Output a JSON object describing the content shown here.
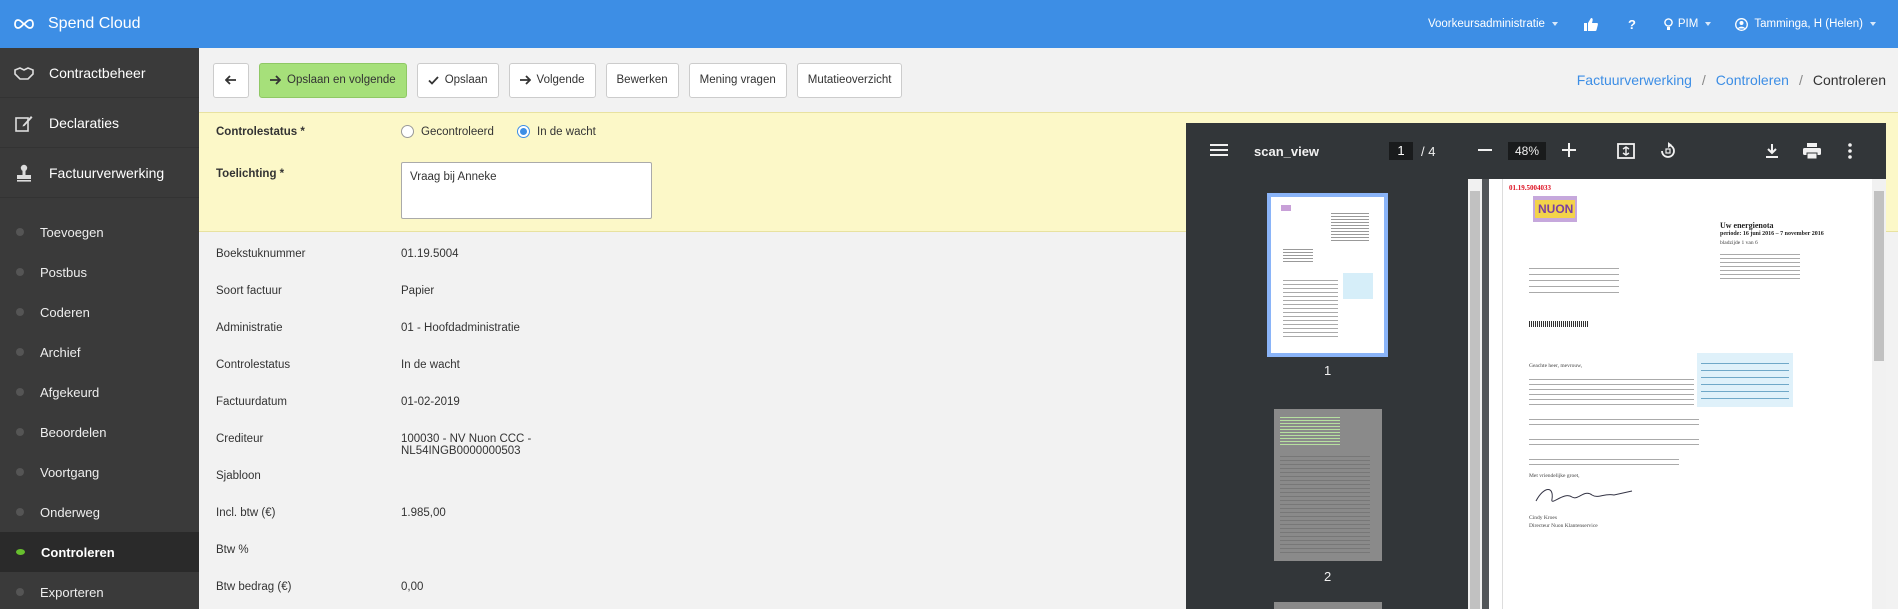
{
  "app": {
    "title": "Spend Cloud"
  },
  "topnav": {
    "administration": "Voorkeursadministratie",
    "pim": "PIM",
    "user": "Tamminga, H (Helen)"
  },
  "sidebar": {
    "main": [
      {
        "label": "Contractbeheer",
        "icon": "handshake-icon"
      },
      {
        "label": "Declaraties",
        "icon": "pencil-icon"
      },
      {
        "label": "Factuurverwerking",
        "icon": "stamp-icon"
      }
    ],
    "sub": [
      {
        "label": "Toevoegen"
      },
      {
        "label": "Postbus"
      },
      {
        "label": "Coderen"
      },
      {
        "label": "Archief"
      },
      {
        "label": "Afgekeurd"
      },
      {
        "label": "Beoordelen"
      },
      {
        "label": "Voortgang"
      },
      {
        "label": "Onderweg"
      },
      {
        "label": "Controleren",
        "active": true
      },
      {
        "label": "Exporteren"
      }
    ]
  },
  "toolbar": {
    "save_next": "Opslaan en volgende",
    "save": "Opslaan",
    "next": "Volgende",
    "edit": "Bewerken",
    "opinion": "Mening vragen",
    "mutations": "Mutatieoverzicht"
  },
  "breadcrumb": {
    "items": [
      "Factuurverwerking",
      "Controleren"
    ],
    "current": "Controleren"
  },
  "form": {
    "status_label": "Controlestatus *",
    "opt_checked": "Gecontroleerd",
    "opt_waiting": "In de wacht",
    "selected": "In de wacht",
    "note_label": "Toelichting *",
    "note_value": "Vraag bij Anneke"
  },
  "details": [
    {
      "label": "Boekstuknummer",
      "value": "01.19.5004"
    },
    {
      "label": "Soort factuur",
      "value": "Papier"
    },
    {
      "label": "Administratie",
      "value": "01 - Hoofdadministratie"
    },
    {
      "label": "Controlestatus",
      "value": "In de wacht"
    },
    {
      "label": "Factuurdatum",
      "value": "01-02-2019"
    },
    {
      "label": "Crediteur",
      "value": "100030 - NV Nuon CCC -",
      "value2": "NL54INGB0000000503"
    },
    {
      "label": "Sjabloon",
      "value": ""
    },
    {
      "label": "Incl. btw (€)",
      "value": "1.985,00"
    },
    {
      "label": "Btw %",
      "value": ""
    },
    {
      "label": "Btw bedrag (€)",
      "value": "0,00"
    }
  ],
  "viewer": {
    "title": "scan_view",
    "page": "1",
    "pages": "/ 4",
    "zoom": "48%",
    "thumb1": "1",
    "thumb2": "2"
  },
  "document": {
    "logo": "NUON",
    "stamp": "01.19.5004033",
    "heading": "Uw energienota",
    "period": "periode: 16 juni 2016 – 7 november 2016",
    "sheet": "bladzijde 1 van 6",
    "greeting": "Geachte heer, mevrouw,",
    "closing": "Met vriendelijke groet,",
    "signer": "Cindy Kroes",
    "signer_role": "Directeur Nuon Klantenservice"
  }
}
